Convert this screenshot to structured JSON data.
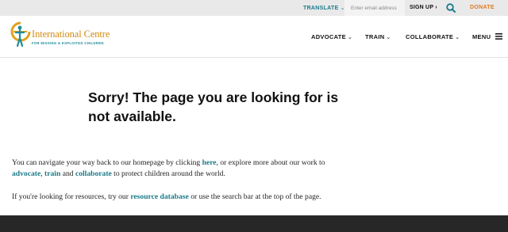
{
  "utility_bar": {
    "translate_label": "TRANSLATE",
    "email_placeholder": "Enter email address",
    "signup_label": "SIGN UP",
    "search_icon": "search-icon",
    "donate_label": "DONATE"
  },
  "header": {
    "logo_name": "International Centre",
    "logo_tagline": "FOR MISSING & EXPLOITED CHILDREN",
    "nav": {
      "advocate": "ADVOCATE",
      "train": "TRAIN",
      "collaborate": "COLLABORATE",
      "menu": "MENU"
    }
  },
  "main": {
    "title": "Sorry! The page you are looking for is not available.",
    "para1": {
      "t1": "You can navigate your way back to our homepage by clicking ",
      "link_here": "here",
      "t2": ", or explore more about our work to ",
      "link_advocate": "advocate",
      "t3": ", ",
      "link_train": "train",
      "t4": " and ",
      "link_collaborate": "collaborate",
      "t5": " to protect children around the world."
    },
    "para2": {
      "t1": "If you're looking for resources, try our ",
      "link_resource": "resource database",
      "t2": " or use the search bar at the top of the page."
    }
  },
  "colors": {
    "accent_teal": "#1a7a88",
    "donate_orange": "#e07a1f",
    "logo_gold": "#d48a10",
    "footer_dark": "#272727"
  }
}
